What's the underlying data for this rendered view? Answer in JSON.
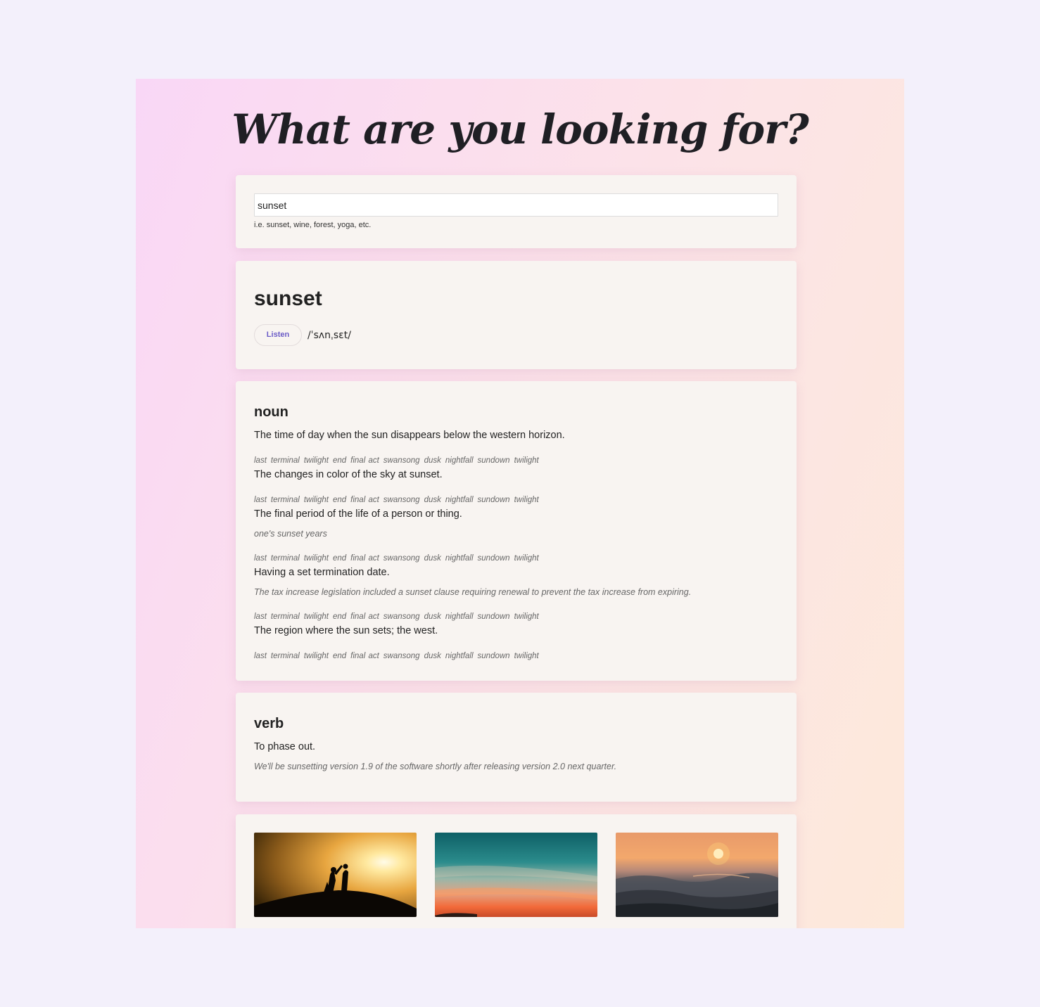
{
  "heading": "What are you looking for?",
  "search": {
    "value": "sunset",
    "hint": "i.e. sunset, wine, forest, yoga, etc."
  },
  "word": {
    "title": "sunset",
    "listen_label": "Listen",
    "phonetic": "/ˈsʌnˌsɛt/"
  },
  "noun": {
    "label": "noun",
    "definitions": [
      {
        "text": "The time of day when the sun disappears below the western horizon.",
        "example": ""
      },
      {
        "text": "The changes in color of the sky at sunset.",
        "example": ""
      },
      {
        "text": "The final period of the life of a person or thing.",
        "example": "one's sunset years"
      },
      {
        "text": "Having a set termination date.",
        "example": "The tax increase legislation included a sunset clause requiring renewal to prevent the tax increase from expiring."
      },
      {
        "text": "The region where the sun sets; the west.",
        "example": ""
      }
    ],
    "synonyms": [
      "last",
      "terminal",
      "twilight",
      "end",
      "final act",
      "swansong",
      "dusk",
      "nightfall",
      "sundown",
      "twilight"
    ]
  },
  "verb": {
    "label": "verb",
    "definition": "To phase out.",
    "example": "We'll be sunsetting version 1.9 of the software shortly after releasing version 2.0 next quarter."
  },
  "images": [
    {
      "name": "silhouette-couple-sunset-photo"
    },
    {
      "name": "teal-orange-sky-photo"
    },
    {
      "name": "ocean-sunset-photo"
    }
  ]
}
